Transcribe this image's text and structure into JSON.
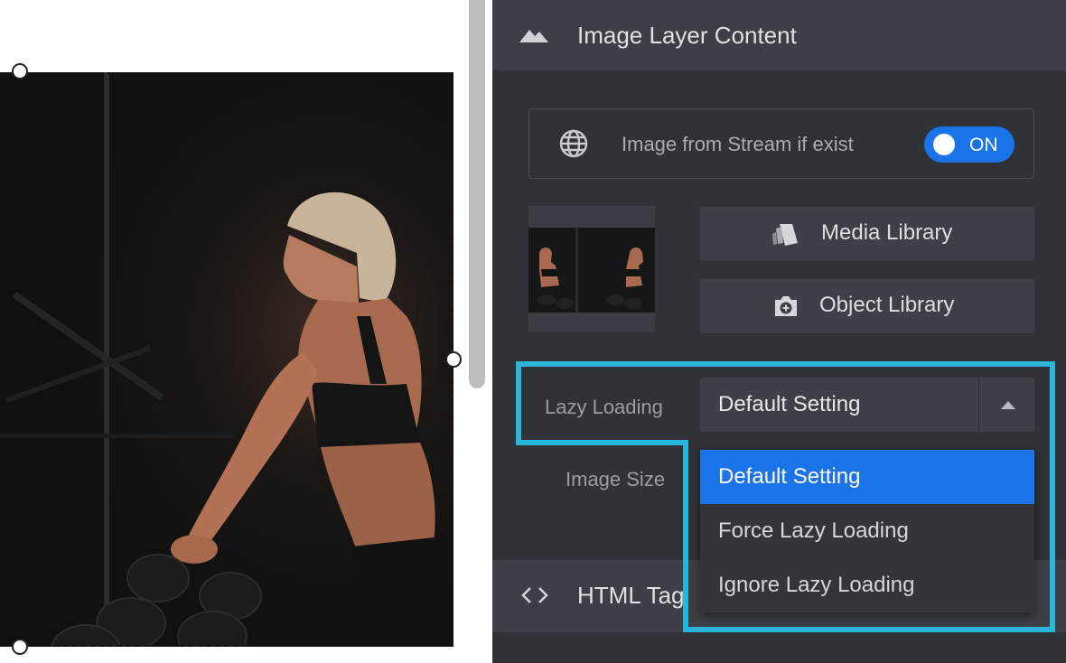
{
  "panel": {
    "header_title": "Image Layer Content",
    "header_icon": "mountain-icon"
  },
  "stream": {
    "label": "Image from Stream if exist",
    "toggle_state": "ON",
    "icon": "globe-icon"
  },
  "buttons": {
    "media_library": "Media Library",
    "object_library": "Object Library"
  },
  "lazy_loading": {
    "label": "Lazy Loading",
    "selected": "Default Setting",
    "options": [
      "Default Setting",
      "Force Lazy Loading",
      "Ignore Lazy Loading"
    ]
  },
  "image_size": {
    "label": "Image Size"
  },
  "html_tag": {
    "title": "HTML Tag",
    "icon": "code-icon"
  },
  "colors": {
    "accent": "#1a73e8",
    "highlight": "#29b6d8",
    "panel_bg": "#2f3237"
  }
}
